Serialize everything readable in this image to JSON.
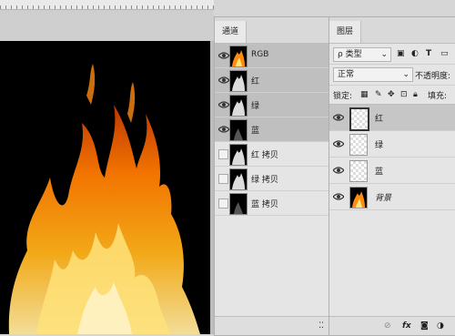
{
  "channels": {
    "tab": "通道",
    "rows": [
      {
        "name": "RGB",
        "visible": true,
        "selected": true,
        "thumb": "color"
      },
      {
        "name": "红",
        "visible": true,
        "selected": true,
        "thumb": "gray"
      },
      {
        "name": "绿",
        "visible": true,
        "selected": true,
        "thumb": "gray"
      },
      {
        "name": "蓝",
        "visible": true,
        "selected": true,
        "thumb": "dark"
      },
      {
        "name": "红 拷贝",
        "visible": false,
        "selected": false,
        "thumb": "gray"
      },
      {
        "name": "绿 拷贝",
        "visible": false,
        "selected": false,
        "thumb": "gray"
      },
      {
        "name": "蓝 拷贝",
        "visible": false,
        "selected": false,
        "thumb": "dark"
      }
    ]
  },
  "layers": {
    "tab": "图层",
    "filter_kind": "ρ 类型",
    "blend_mode": "正常",
    "opacity_label": "不透明度:",
    "lock_label": "锁定:",
    "fill_label": "填充:",
    "items": [
      {
        "name": "红",
        "selected": true,
        "thumb": "transparent"
      },
      {
        "name": "绿",
        "selected": false,
        "thumb": "transparent"
      },
      {
        "name": "蓝",
        "selected": false,
        "thumb": "transparent"
      },
      {
        "name": "背景",
        "selected": false,
        "thumb": "fire"
      }
    ],
    "footer_icons": [
      "link-icon",
      "fx-icon",
      "mask-icon",
      "adjustment-icon"
    ],
    "fx_label": "fx"
  },
  "colors": {
    "selected_row": "#bfbfbf",
    "panel_bg": "#e5e5e5",
    "canvas_bg": "#000000"
  }
}
